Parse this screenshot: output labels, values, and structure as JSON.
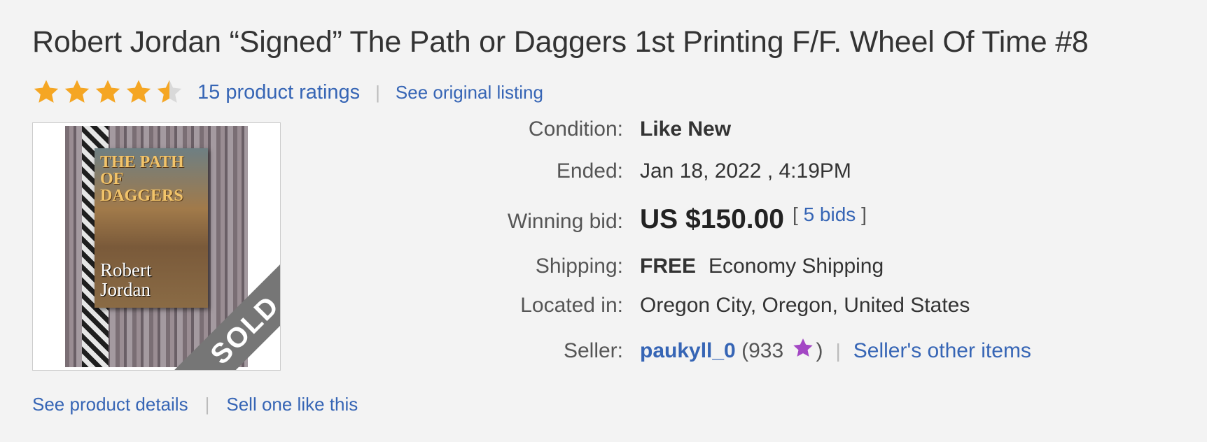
{
  "listing": {
    "title": "Robert Jordan “Signed” The Path or Daggers 1st Printing F/F. Wheel Of Time #8",
    "rating_value": 4.5,
    "ratings_link": "15 product ratings",
    "original_listing_link": "See original listing",
    "photo": {
      "book_title": "THE PATH OF DAGGERS",
      "book_author": "Robert Jordan",
      "sold_label": "SOLD"
    }
  },
  "details": {
    "condition_label": "Condition:",
    "condition_value": "Like New",
    "ended_label": "Ended:",
    "ended_value": "Jan 18, 2022 , 4:19PM",
    "winning_bid_label": "Winning bid:",
    "winning_bid_value": "US $150.00",
    "bids_open": "[",
    "bids_link": "5 bids",
    "bids_close": "]",
    "shipping_label": "Shipping:",
    "shipping_free": "FREE",
    "shipping_method": "Economy Shipping",
    "location_label": "Located in:",
    "location_value": "Oregon City, Oregon, United States",
    "seller_label": "Seller:",
    "seller_name": "paukyll_0",
    "seller_open": "(",
    "seller_score": "933",
    "seller_close": ")",
    "seller_other_items": "Seller's other items"
  },
  "bottom_links": {
    "product_details": "See product details",
    "sell_one": "Sell one like this"
  },
  "colors": {
    "link": "#3665b5",
    "star": "#f5a623",
    "seller_star": "#a347c4",
    "background": "#f3f3f3"
  }
}
